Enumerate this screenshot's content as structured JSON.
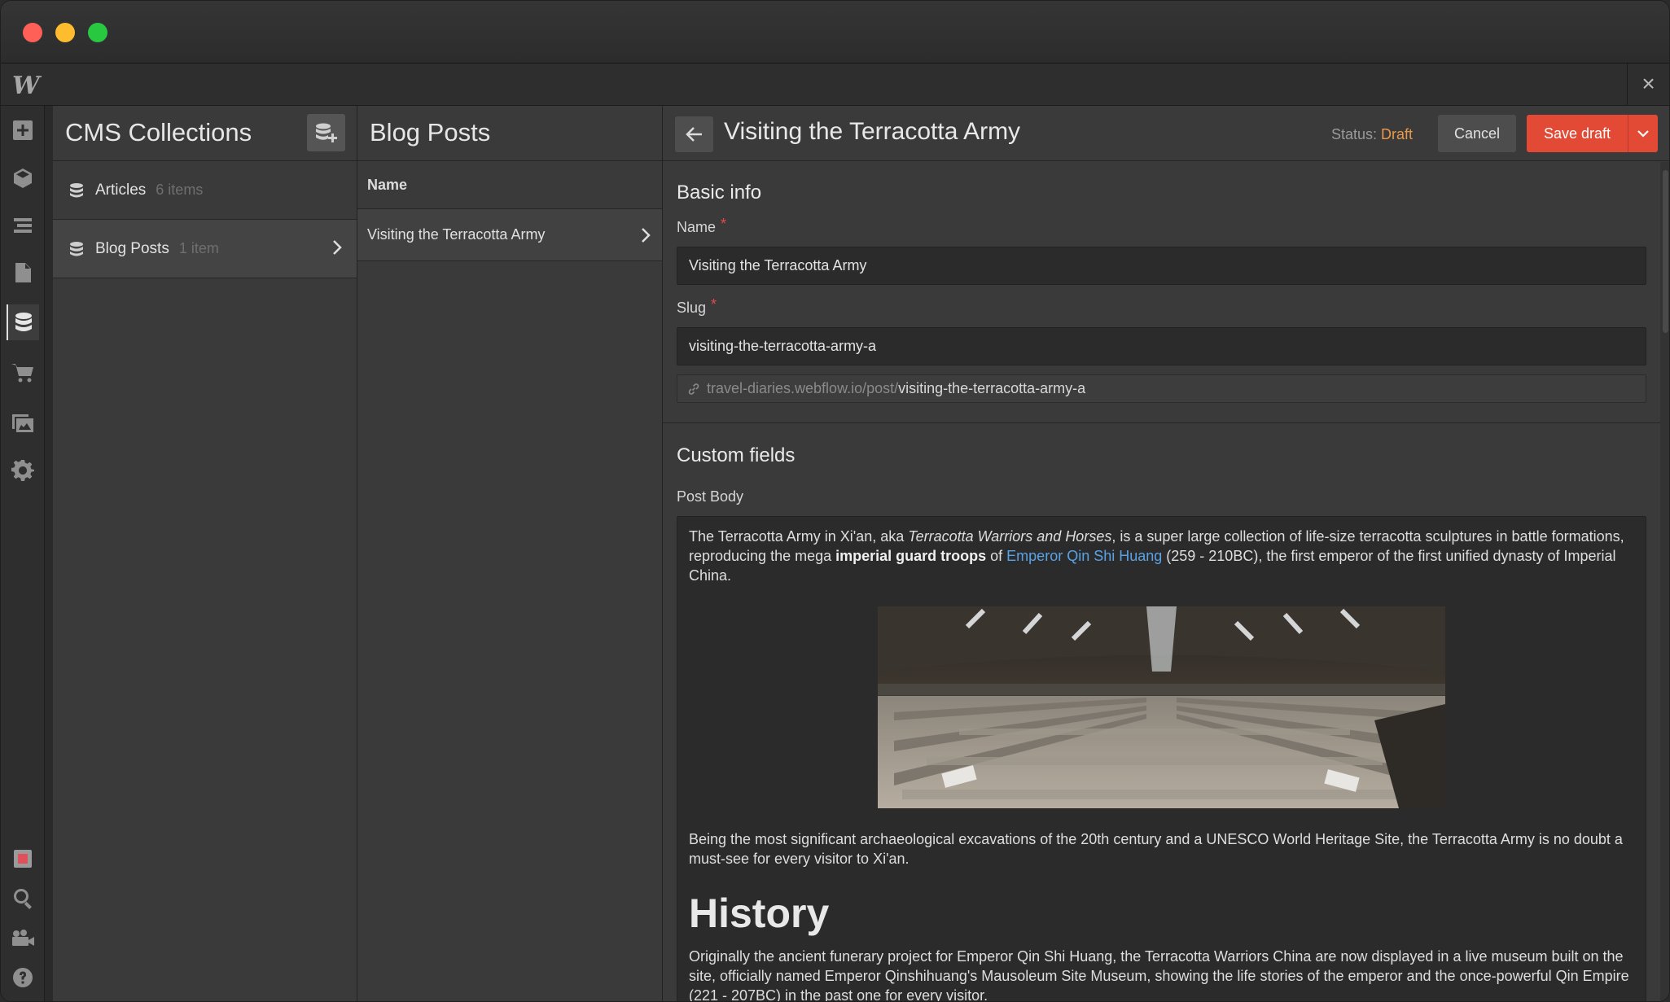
{
  "app": {
    "logo": "W",
    "close_label": "×"
  },
  "rail": {
    "items": [
      {
        "name": "add-icon"
      },
      {
        "name": "components-cube-icon"
      },
      {
        "name": "navigator-icon"
      },
      {
        "name": "pages-icon"
      },
      {
        "name": "cms-database-icon"
      },
      {
        "name": "ecommerce-cart-icon"
      },
      {
        "name": "assets-images-icon"
      },
      {
        "name": "settings-gear-icon"
      }
    ],
    "bottom": [
      {
        "name": "audit-icon"
      },
      {
        "name": "search-icon"
      },
      {
        "name": "tutorials-video-icon"
      },
      {
        "name": "help-icon"
      }
    ]
  },
  "collections": {
    "title": "CMS Collections",
    "items": [
      {
        "name": "Articles",
        "count": "6 items"
      },
      {
        "name": "Blog Posts",
        "count": "1 item"
      }
    ]
  },
  "posts": {
    "title": "Blog Posts",
    "column_header": "Name",
    "items": [
      {
        "name": "Visiting the Terracotta Army"
      }
    ]
  },
  "editor": {
    "title": "Visiting the Terracotta Army",
    "status_label": "Status:",
    "status_value": "Draft",
    "cancel_label": "Cancel",
    "save_label": "Save draft",
    "basic_info": {
      "heading": "Basic info",
      "name_label": "Name",
      "name_value": "Visiting the Terracotta Army",
      "slug_label": "Slug",
      "slug_value": "visiting-the-terracotta-army-a",
      "url_base": "travel-diaries.webflow.io/post/",
      "url_slug": "visiting-the-terracotta-army-a",
      "required_mark": "*"
    },
    "custom_fields": {
      "heading": "Custom fields",
      "post_body_label": "Post Body",
      "p1_a": "The Terracotta Army in Xi'an, aka ",
      "p1_italic": "Terracotta Warriors and Horses",
      "p1_b": ", is a super large collection of life-size terracotta sculptures in battle formations, reproducing the mega ",
      "p1_bold": "imperial guard troops",
      "p1_c": " of ",
      "p1_link": "Emperor Qin Shi Huang",
      "p1_d": " (259 - 210BC), the first emperor of the first unified dynasty of Imperial China.",
      "p2": "Being the most significant archaeological excavations of the 20th century and a UNESCO World Heritage Site, the Terracotta Army is no doubt a must-see for every visitor to Xi'an.",
      "h1": "History",
      "p3": "Originally the ancient funerary project for Emperor Qin Shi Huang, the Terracotta Warriors China are now displayed in a live museum built on the site, officially named Emperor Qinshihuang's Mausoleum Site Museum, showing the life stories of the emperor and the once-powerful Qin Empire (221 - 207BC) in the past one for every visitor."
    }
  }
}
